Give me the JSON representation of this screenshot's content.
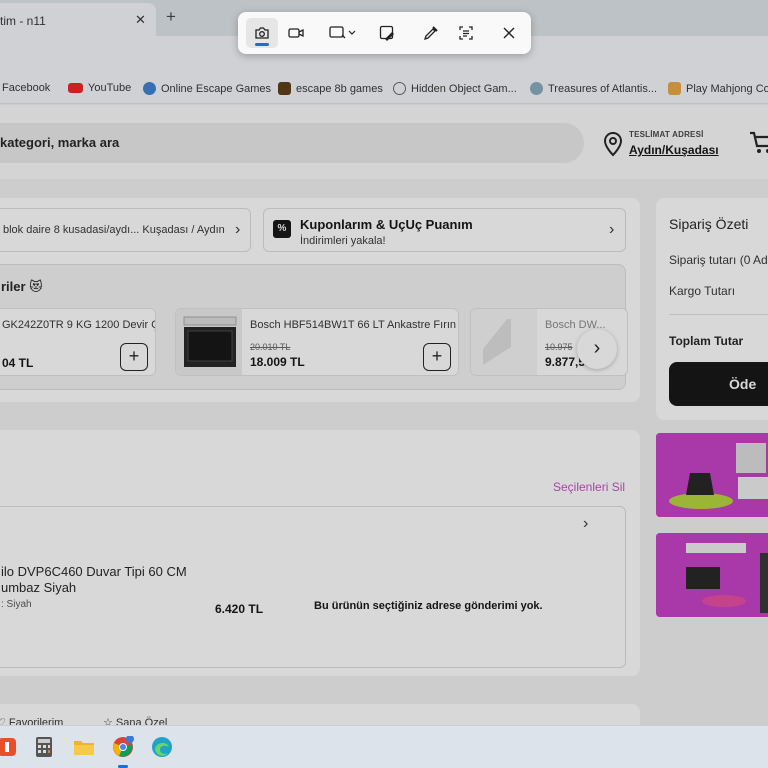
{
  "browser": {
    "tab_title": "tim - n11",
    "tab_close": "✕",
    "new_tab": "+",
    "bookmarks": [
      "Facebook",
      "YouTube",
      "Online Escape Games",
      "escape 8b games",
      "Hidden Object Gam...",
      "Treasures of Atlantis...",
      "Play Mahjong Co"
    ]
  },
  "header": {
    "search_placeholder": "kategori, marka ara",
    "delivery_label": "TESLİMAT ADRESİ",
    "delivery_value": "Aydın/Kuşadası"
  },
  "address": {
    "text": "blok daire 8 kusadasi/aydı... Kuşadası / Aydın"
  },
  "coupons": {
    "icon": "%",
    "title": "Kuponlarım & UçUç Puanım",
    "subtitle": "İndirimleri yakala!"
  },
  "recommendations": {
    "title": "riler 😻",
    "products": [
      {
        "name": "GK242Z0TR 9 KG 1200 Devir Ç...",
        "old_price": "",
        "price": "04 TL"
      },
      {
        "name": "Bosch HBF514BW1T 66 LT Ankastre Fırın",
        "old_price": "20.010 TL",
        "price": "18.009 TL"
      },
      {
        "name": "Bosch DW...",
        "old_price": "10.975",
        "price": "9.877,5..."
      }
    ],
    "next": "›"
  },
  "basket": {
    "delete_selected": "Seçilenleri Sil",
    "item_name": "ilo DVP6C460 Duvar Tipi 60 CM umbaz Siyah",
    "item_color": ": Siyah",
    "item_price": "6.420 TL",
    "item_warning": "Bu ürünün seçtiğiniz adrese gönderimi yok."
  },
  "bottom": {
    "favorites": "Favorilerim",
    "save_for_later": "Sana Özel"
  },
  "summary": {
    "title": "Sipariş Özeti",
    "order_amount": "Sipariş tutarı (0 Ad",
    "shipping": "Kargo Tutarı",
    "total": "Toplam Tutar",
    "pay_button": "Öde"
  },
  "colors": {
    "accent_pink": "#c44cc1",
    "snip_accent": "#1a6fcf",
    "dark_button": "#111111"
  }
}
